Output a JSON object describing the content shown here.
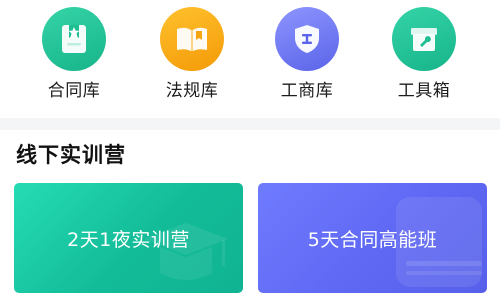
{
  "quick_links": [
    {
      "label": "合同库",
      "icon": "contract-bookmark-icon",
      "color": "#1fc397"
    },
    {
      "label": "法规库",
      "icon": "open-book-icon",
      "color": "#f8a816"
    },
    {
      "label": "工商库",
      "icon": "shield-icon",
      "color": "#6a73f0"
    },
    {
      "label": "工具箱",
      "icon": "toolbox-icon",
      "color": "#1fc397"
    }
  ],
  "training": {
    "title": "线下实训营",
    "cards": [
      {
        "label": "2天1夜实训营",
        "color": "#19c7a1",
        "icon": "graduation-cap-icon"
      },
      {
        "label": "5天合同高能班",
        "color": "#656ef7",
        "icon": "book-stack-icon"
      }
    ]
  }
}
